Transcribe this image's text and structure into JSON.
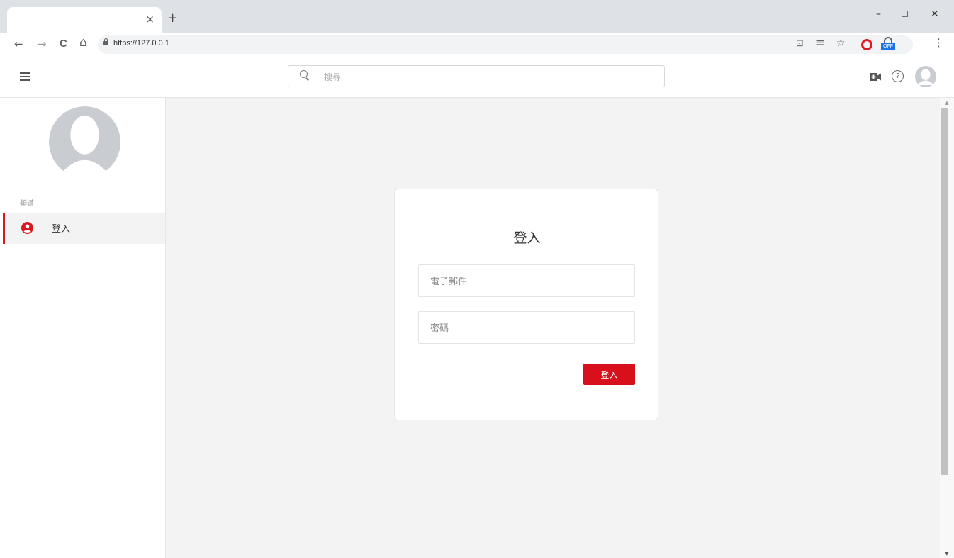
{
  "browser": {
    "tab_close": "×",
    "new_tab": "+",
    "window": {
      "minimize": "–",
      "maximize": "☐",
      "close": "✕"
    },
    "nav": {
      "back": "←",
      "forward": "→",
      "reload": "C",
      "home": "⌂"
    },
    "url": "https://127.0.0.1",
    "extensions": {
      "cast": "⊡",
      "reading_list": "≡",
      "bookmark": "☆",
      "adblock_label": "OFF",
      "more": "⋮"
    }
  },
  "header": {
    "search": {
      "placeholder": "搜尋",
      "value": ""
    },
    "help_glyph": "?"
  },
  "sidebar": {
    "section_label": "類道",
    "items": [
      {
        "label": "登入",
        "active": true
      }
    ]
  },
  "login": {
    "title": "登入",
    "email_placeholder": "電子郵件",
    "password_placeholder": "密碼",
    "submit_label": "登入"
  },
  "scrollbar": {
    "up": "▲",
    "down": "▼"
  },
  "colors": {
    "accent": "#d7101b",
    "sidebar_active_border": "#d71920",
    "main_background": "#f3f3f3",
    "avatar_gray": "#c9ccd1"
  },
  "icons": {
    "menu": "hamburger-menu-icon",
    "search": "search-icon",
    "camera": "video-camera-icon",
    "help": "help-circle-icon",
    "avatar": "user-avatar-icon",
    "sidebar_user": "user-circle-icon"
  }
}
